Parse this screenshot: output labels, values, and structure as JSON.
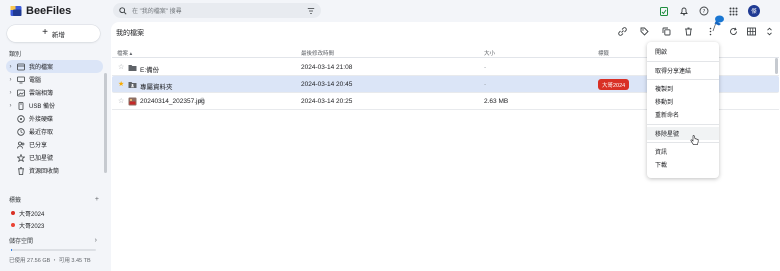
{
  "app": {
    "name": "BeeFiles"
  },
  "search": {
    "placeholder": "在 \"我的檔案\" 搜尋"
  },
  "user": {
    "initial": "傑"
  },
  "sidebar": {
    "new_label": "新增",
    "section_label": "類別",
    "items": [
      {
        "label": "我的檔案",
        "icon": "my-files-icon",
        "caret": true,
        "active": true
      },
      {
        "label": "電腦",
        "icon": "computer-icon",
        "caret": true
      },
      {
        "label": "雲端相簿",
        "icon": "cloud-album-icon",
        "caret": true
      },
      {
        "label": "USB 備份",
        "icon": "usb-backup-icon",
        "caret": true
      },
      {
        "label": "外接硬碟",
        "icon": "external-drive-icon",
        "caret": false
      },
      {
        "label": "最近存取",
        "icon": "recent-icon",
        "caret": false
      },
      {
        "label": "已分享",
        "icon": "shared-icon",
        "caret": false
      },
      {
        "label": "已加星號",
        "icon": "starred-icon",
        "caret": false
      },
      {
        "label": "資源回收筒",
        "icon": "trash-icon",
        "caret": false
      }
    ],
    "tags_label": "標籤",
    "tags": [
      {
        "label": "大哥2024",
        "color": "#d93025"
      },
      {
        "label": "大哥2023",
        "color": "#ea4335"
      }
    ],
    "storage_label": "儲存空間",
    "storage_text": "已使用 27.56 GB ・ 可用 3.45 TB",
    "storage_fraction": 0.008
  },
  "main": {
    "breadcrumb": "我的檔案",
    "columns": {
      "name": "檔案 ▴",
      "modified": "最後修改時間",
      "size": "大小",
      "tags": "標籤"
    },
    "rows": [
      {
        "name": "E:備份",
        "type": "folder",
        "starred": false,
        "modified": "2024-03-14 21:08",
        "size": "-",
        "tag": ""
      },
      {
        "name": "專屬資料夾",
        "type": "shared-folder",
        "starred": true,
        "modified": "2024-03-14 20:45",
        "size": "-",
        "tag": "大哥2024"
      },
      {
        "name": "20240314_202357.jpg",
        "type": "image",
        "starred": false,
        "modified": "2024-03-14 20:25",
        "size": "2.63 MB",
        "tag": ""
      }
    ]
  },
  "menu": {
    "items": [
      {
        "label": "開啟"
      },
      {
        "label": "取得分享連結"
      },
      {
        "label": "複製到"
      },
      {
        "label": "移動到"
      },
      {
        "label": "重新命名"
      },
      {
        "label": "移除星號"
      },
      {
        "label": "資訊"
      },
      {
        "label": "下載"
      }
    ]
  },
  "colors": {
    "accent": "#1a73e8",
    "selected": "#dbe5f7",
    "tag_red": "#d93025"
  }
}
